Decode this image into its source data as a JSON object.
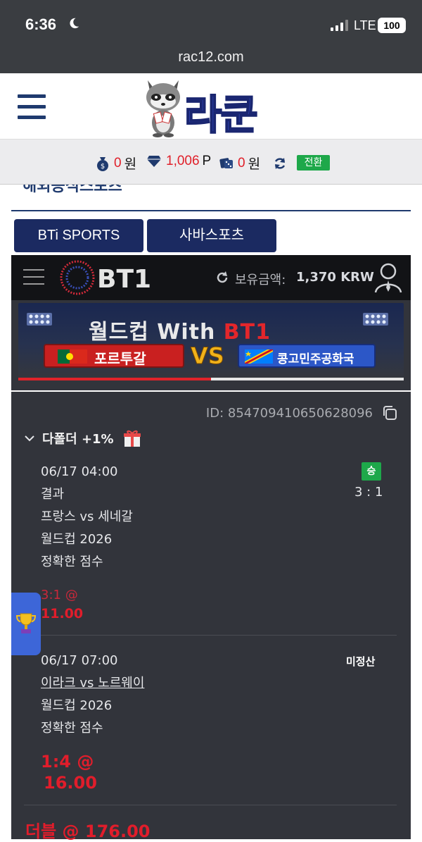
{
  "status_bar": {
    "time": "6:36",
    "network": "LTE",
    "battery": "100"
  },
  "browser": {
    "url": "rac12.com"
  },
  "site": {
    "logo_text": "라쿤"
  },
  "balance": {
    "cash_value": "0",
    "cash_unit": "원",
    "point_value": "1,006",
    "point_unit": "P",
    "game_value": "0",
    "game_unit": "원",
    "switch_label": "전환"
  },
  "partial_heading": "해외공식스포츠",
  "tabs": {
    "bti": "BTi SPORTS",
    "saba": "사바스포츠"
  },
  "bt1": {
    "logo": "BT1",
    "balance_label": "보유금액:",
    "balance_value": "1,370 KRW",
    "banner": {
      "title_prefix": "월드컵 With ",
      "title_brand": "BT1",
      "team_left": "포르투갈",
      "vs": "VS",
      "team_right": "콩고민주공화국",
      "progress": 0.5
    }
  },
  "ticket": {
    "id": "ID: 854709410650628096",
    "folder_label": "다폴더 +1%",
    "bets": [
      {
        "datetime": "06/17 04:00",
        "market": "결과",
        "match": "프랑스 vs 세네갈",
        "league": "월드컵 2026",
        "bet_type": "정확한 점수",
        "status": "승",
        "score": "3 : 1",
        "pick": "3:1 @",
        "odds": "11.00"
      },
      {
        "datetime": "06/17 07:00",
        "market": "",
        "match": "이라크 vs 노르웨이",
        "league": "월드컵 2026",
        "bet_type": "정확한 점수",
        "status": "미정산",
        "score": "",
        "pick": "1:4 @",
        "odds": "16.00"
      }
    ],
    "double_label": "더블 @ 176.00"
  },
  "colors": {
    "accent_red": "#e11d2b",
    "win_green": "#1ea84a",
    "navy": "#1b2a61",
    "panel_bg": "#32343b"
  }
}
